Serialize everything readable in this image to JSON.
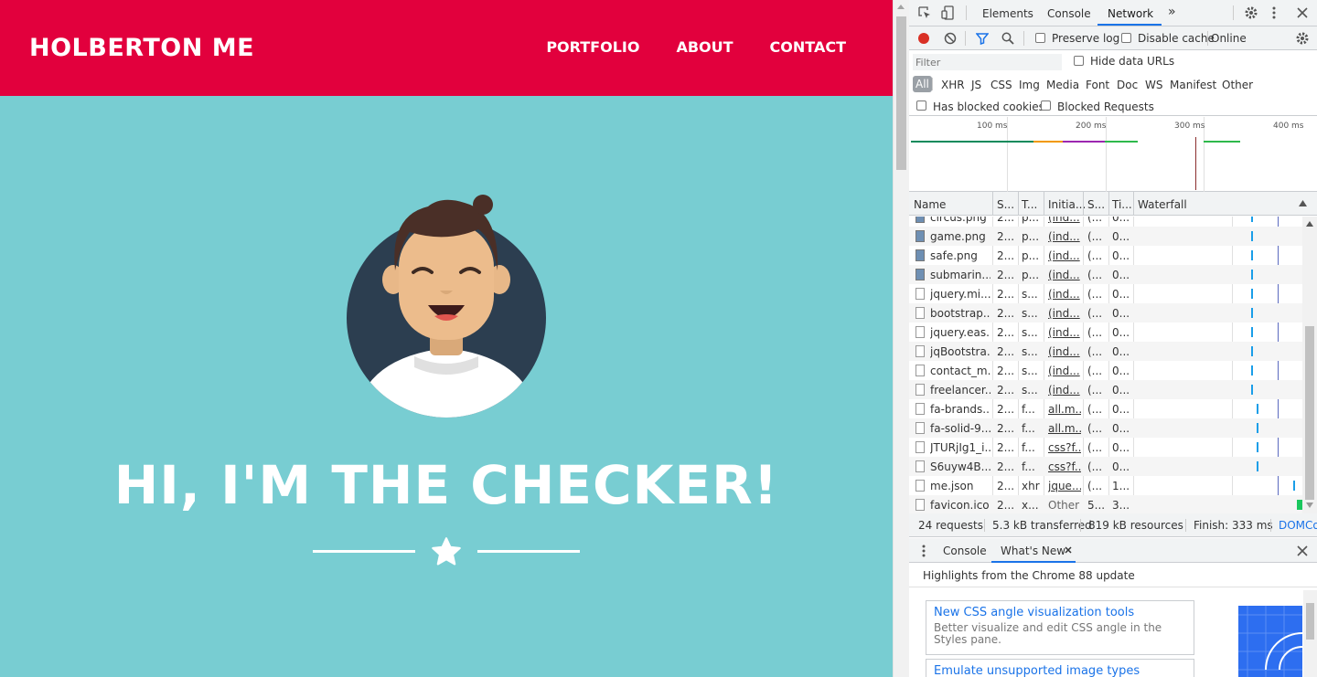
{
  "page": {
    "brand": "HOLBERTON ME",
    "nav": [
      "PORTFOLIO",
      "ABOUT",
      "CONTACT"
    ],
    "hero_title": "HI, I'M THE CHECKER!",
    "colors": {
      "navbar": "#e2003d",
      "hero_bg": "#78cdd2",
      "avatar_circle": "#2c3e50"
    }
  },
  "devtools": {
    "tabs": [
      "Elements",
      "Console",
      "Network"
    ],
    "active_tab": "Network",
    "more_tabs_icon": "»",
    "toolbar": {
      "preserve_log": "Preserve log",
      "disable_cache": "Disable cache",
      "throttling": "Online"
    },
    "filter_placeholder": "Filter",
    "hide_data_urls": "Hide data URLs",
    "types": [
      "All",
      "XHR",
      "JS",
      "CSS",
      "Img",
      "Media",
      "Font",
      "Doc",
      "WS",
      "Manifest",
      "Other"
    ],
    "has_blocked_cookies": "Has blocked cookies",
    "blocked_requests": "Blocked Requests",
    "overview_ticks": [
      "100 ms",
      "200 ms",
      "300 ms",
      "400 ms"
    ],
    "columns": [
      "Name",
      "S...",
      "T...",
      "Initia...",
      "S...",
      "Ti...",
      "Waterfall"
    ],
    "rows": [
      {
        "name": "circus.png",
        "status": "2...",
        "type": "p...",
        "initiator": "(ind...",
        "size": "(...",
        "time": "0...",
        "icon": "image",
        "wf": 0.72
      },
      {
        "name": "game.png",
        "status": "2...",
        "type": "p...",
        "initiator": "(ind...",
        "size": "(...",
        "time": "0...",
        "icon": "image",
        "wf": 0.72
      },
      {
        "name": "safe.png",
        "status": "2...",
        "type": "p...",
        "initiator": "(ind...",
        "size": "(...",
        "time": "0...",
        "icon": "image",
        "wf": 0.72
      },
      {
        "name": "submarin...",
        "status": "2...",
        "type": "p...",
        "initiator": "(ind...",
        "size": "(...",
        "time": "0...",
        "icon": "image",
        "wf": 0.72
      },
      {
        "name": "jquery.mi...",
        "status": "2...",
        "type": "s...",
        "initiator": "(ind...",
        "size": "(...",
        "time": "0...",
        "icon": "doc",
        "wf": 0.72
      },
      {
        "name": "bootstrap....",
        "status": "2...",
        "type": "s...",
        "initiator": "(ind...",
        "size": "(...",
        "time": "0...",
        "icon": "doc",
        "wf": 0.72
      },
      {
        "name": "jquery.eas...",
        "status": "2...",
        "type": "s...",
        "initiator": "(ind...",
        "size": "(...",
        "time": "0...",
        "icon": "doc",
        "wf": 0.72
      },
      {
        "name": "jqBootstra...",
        "status": "2...",
        "type": "s...",
        "initiator": "(ind...",
        "size": "(...",
        "time": "0...",
        "icon": "doc",
        "wf": 0.72
      },
      {
        "name": "contact_m...",
        "status": "2...",
        "type": "s...",
        "initiator": "(ind...",
        "size": "(...",
        "time": "0...",
        "icon": "doc",
        "wf": 0.72
      },
      {
        "name": "freelancer....",
        "status": "2...",
        "type": "s...",
        "initiator": "(ind...",
        "size": "(...",
        "time": "0...",
        "icon": "doc",
        "wf": 0.72
      },
      {
        "name": "fa-brands...",
        "status": "2...",
        "type": "f...",
        "initiator": "all.m...",
        "size": "(...",
        "time": "0...",
        "icon": "doc",
        "wf": 0.75
      },
      {
        "name": "fa-solid-9...",
        "status": "2...",
        "type": "f...",
        "initiator": "all.m...",
        "size": "(...",
        "time": "0...",
        "icon": "doc",
        "wf": 0.75
      },
      {
        "name": "JTURjIg1_i...",
        "status": "2...",
        "type": "f...",
        "initiator": "css?f...",
        "size": "(...",
        "time": "0...",
        "icon": "doc",
        "wf": 0.75
      },
      {
        "name": "S6uyw4B...",
        "status": "2...",
        "type": "f...",
        "initiator": "css?f...",
        "size": "(...",
        "time": "0...",
        "icon": "doc",
        "wf": 0.75
      },
      {
        "name": "me.json",
        "status": "2...",
        "type": "xhr",
        "initiator": "jque...",
        "size": "(...",
        "time": "1...",
        "icon": "doc",
        "wf": 0.97
      },
      {
        "name": "favicon.ico",
        "status": "2...",
        "type": "x...",
        "initiator": "Other",
        "size": "5...",
        "time": "3...",
        "icon": "doc",
        "wf": 0.99
      }
    ],
    "summary": {
      "requests": "24 requests",
      "transferred": "5.3 kB transferred",
      "resources": "819 kB resources",
      "finish": "Finish: 333 ms",
      "domc": "DOMCo"
    },
    "drawer_tabs": [
      "Console",
      "What's New"
    ],
    "whats_new_heading": "Highlights from the Chrome 88 update",
    "cards": [
      {
        "title": "New CSS angle visualization tools",
        "desc": "Better visualize and edit CSS angle in the Styles pane."
      },
      {
        "title": "Emulate unsupported image types",
        "desc": ""
      }
    ]
  }
}
